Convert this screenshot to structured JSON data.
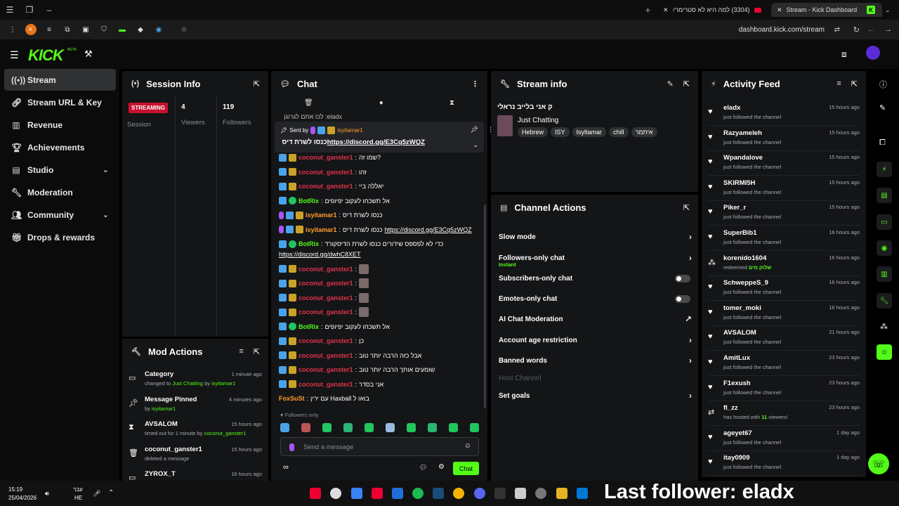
{
  "browser": {
    "tabs": [
      {
        "title": "Stream - Kick Dashboard"
      },
      {
        "title": "(3304) למה היא לא סטרימרית"
      }
    ],
    "url": "dashboard.kick.com/stream"
  },
  "app": {
    "logo": "KICK",
    "logo_badge": "BETA",
    "accent": "#53fc18"
  },
  "sidebar": {
    "items": [
      {
        "label": "Stream",
        "icon": "broadcast-icon",
        "active": true
      },
      {
        "label": "Stream URL & Key",
        "icon": "link-icon"
      },
      {
        "label": "Revenue",
        "icon": "chart-icon"
      },
      {
        "label": "Achievements",
        "icon": "trophy-icon"
      },
      {
        "label": "Studio",
        "icon": "studio-icon",
        "expandable": true
      },
      {
        "label": "Moderation",
        "icon": "wrench-icon"
      },
      {
        "label": "Community",
        "icon": "people-icon",
        "expandable": true
      },
      {
        "label": "Drops & rewards",
        "icon": "gift-icon"
      }
    ]
  },
  "session": {
    "title": "Session Info",
    "status": "STREAMING",
    "status_label": "Session",
    "viewers": "4",
    "viewers_label": "Viewers",
    "followers": "119",
    "followers_label": "Followers"
  },
  "mod_actions": {
    "title": "Mod Actions",
    "items": [
      {
        "icon": "category-icon",
        "name": "Category",
        "sub1": "changed to ",
        "sub_hl": "Just Chatting",
        "sub2": " by ",
        "sub_user": "isyitamar1",
        "time": "1 minute ago"
      },
      {
        "icon": "pin-icon",
        "name": "Message Pinned",
        "sub1": "by ",
        "sub_hl": "",
        "sub2": "",
        "sub_user": "isyitamar1",
        "time": "4 minutes ago"
      },
      {
        "icon": "hourglass-icon",
        "name": "AVSALOM",
        "sub1": "timed out for 1 minute by ",
        "sub_hl": "",
        "sub2": "",
        "sub_user": "coconut_ganster1",
        "time": "15 hours ago"
      },
      {
        "icon": "trash-icon",
        "name": "coconut_ganster1",
        "sub1": "deleted a message",
        "sub_hl": "",
        "sub2": "",
        "sub_user": "",
        "time": "15 hours ago"
      },
      {
        "icon": "category-icon",
        "name": "ZYROX_T",
        "sub1": "",
        "sub_hl": "",
        "sub2": "",
        "sub_user": "",
        "time": "16 hours ago"
      }
    ]
  },
  "chat": {
    "title": "Chat",
    "top_partial": "eladx: לכו אתם לגרוגן",
    "pinned": {
      "sent_by_label": "Sent by",
      "user": "isyitamar1",
      "text": "כנסו לשרת דיס ",
      "link": "https://discord.gg/E3Cq5zWQZ"
    },
    "messages": [
      {
        "user": "coconut_ganster1",
        "color": "red",
        "badges": [
          "mod",
          "vip"
        ],
        "text": "?שמו זה"
      },
      {
        "user": "coconut_ganster1",
        "color": "red",
        "badges": [
          "mod",
          "vip"
        ],
        "text": "זהו"
      },
      {
        "user": "coconut_ganster1",
        "color": "red",
        "badges": [
          "mod",
          "vip"
        ],
        "text": "יאללה ביי"
      },
      {
        "user": "BotRix",
        "color": "green",
        "badges": [
          "mod",
          "bot"
        ],
        "text": "אל תשכחו לעקוב יפיופים"
      },
      {
        "user": "isyitamar1",
        "color": "orange",
        "badges": [
          "mic",
          "mod",
          "vip"
        ],
        "text": "כנסו לשרת דיס"
      },
      {
        "user": "isyitamar1",
        "color": "orange",
        "badges": [
          "mic",
          "mod",
          "vip"
        ],
        "text": "כנסו לשרת דיס ",
        "link": "https://discord.gg/E3Cq5zWQZ"
      },
      {
        "user": "BotRix",
        "color": "green",
        "badges": [
          "mod",
          "bot"
        ],
        "text": "כדי לא לפספס שידורים כנסו לשרת הדיסקורד",
        "link2": "https://discord.gg/dwhC8XET"
      },
      {
        "user": "coconut_ganster1",
        "color": "red",
        "badges": [
          "mod",
          "vip"
        ],
        "text": "",
        "emote": true
      },
      {
        "user": "coconut_ganster1",
        "color": "red",
        "badges": [
          "mod",
          "vip"
        ],
        "text": "",
        "emote": true
      },
      {
        "user": "coconut_ganster1",
        "color": "red",
        "badges": [
          "mod",
          "vip"
        ],
        "text": "",
        "emote": true
      },
      {
        "user": "coconut_ganster1",
        "color": "red",
        "badges": [
          "mod",
          "vip"
        ],
        "text": "",
        "emote": true
      },
      {
        "user": "BotRix",
        "color": "green",
        "badges": [
          "mod",
          "bot"
        ],
        "text": "אל תשכחו לעקוב יפיופים"
      },
      {
        "user": "coconut_ganster1",
        "color": "red",
        "badges": [
          "mod",
          "vip"
        ],
        "text": "כן"
      },
      {
        "user": "coconut_ganster1",
        "color": "red",
        "badges": [
          "mod",
          "vip"
        ],
        "text": "אבל כזה הרבה יותר טוב"
      },
      {
        "user": "coconut_ganster1",
        "color": "red",
        "badges": [
          "mod",
          "vip"
        ],
        "text": "שומעים אותך הרבה יותר טוב"
      },
      {
        "user": "coconut_ganster1",
        "color": "red",
        "badges": [
          "mod",
          "vip"
        ],
        "text": "אני בסדר"
      },
      {
        "user": "FoxSuSt",
        "color": "orange",
        "badges": [],
        "text": "בואו ל Haxball עם ירין"
      }
    ],
    "followers_only_label": "Followers only",
    "input_placeholder": "Send a message",
    "send_label": "Chat"
  },
  "stream_info": {
    "title": "Stream info",
    "stream_title": "ק אני בלייב נראלי",
    "category": "Just Chatting",
    "tags": [
      "Hebrew",
      "ISY",
      "Isyltamar",
      "chill",
      "איתמר"
    ]
  },
  "channel_actions": {
    "title": "Channel Actions",
    "items": [
      {
        "label": "Slow mode",
        "control": "arrow"
      },
      {
        "label": "Followers-only chat",
        "sub": "Instant",
        "control": "arrow"
      },
      {
        "label": "Subscribers-only chat",
        "control": "toggle",
        "on": false
      },
      {
        "label": "Emotes-only chat",
        "control": "toggle",
        "on": false
      },
      {
        "label": "AI Chat Moderation",
        "control": "external"
      },
      {
        "label": "Account age restriction",
        "control": "arrow"
      },
      {
        "label": "Banned words",
        "control": "arrow"
      },
      {
        "label": "Host Channel",
        "control": "none",
        "disabled": true
      },
      {
        "label": "Set goals",
        "control": "arrow"
      }
    ]
  },
  "activity": {
    "title": "Activity Feed",
    "items": [
      {
        "icon": "heart-icon",
        "name": "eladx",
        "sub": "just followed the channel",
        "time": "15 hours ago"
      },
      {
        "icon": "heart-icon",
        "name": "Razyameleh",
        "sub": "just followed the channel",
        "time": "15 hours ago"
      },
      {
        "icon": "heart-icon",
        "name": "Wpandalove",
        "sub": "just followed the channel",
        "time": "15 hours ago"
      },
      {
        "icon": "heart-icon",
        "name": "SKIRMI5H",
        "sub": "just followed the channel",
        "time": "15 hours ago"
      },
      {
        "icon": "heart-icon",
        "name": "Piker_r",
        "sub": "just followed the channel",
        "time": "15 hours ago"
      },
      {
        "icon": "heart-icon",
        "name": "SuperBib1",
        "sub": "just followed the channel",
        "time": "16 hours ago"
      },
      {
        "icon": "redeem-icon",
        "name": "korenido1604",
        "sub": "redeemed ",
        "sub_hl": "שלוק מים",
        "time": "16 hours ago"
      },
      {
        "icon": "heart-icon",
        "name": "SchweppeS_9",
        "sub": "just followed the channel",
        "time": "16 hours ago"
      },
      {
        "icon": "heart-icon",
        "name": "tomer_moki",
        "sub": "just followed the channel",
        "time": "16 hours ago"
      },
      {
        "icon": "heart-icon",
        "name": "AVSALOM",
        "sub": "just followed the channel",
        "time": "21 hours ago"
      },
      {
        "icon": "heart-icon",
        "name": "AmitLux",
        "sub": "just followed the channel",
        "time": "23 hours ago"
      },
      {
        "icon": "heart-icon",
        "name": "F1exush",
        "sub": "just followed the channel",
        "time": "23 hours ago"
      },
      {
        "icon": "host-icon",
        "name": "fl_zz",
        "sub": "has hosted with ",
        "sub_hl": "11",
        "sub_tail": " viewers!",
        "time": "23 hours ago"
      },
      {
        "icon": "heart-icon",
        "name": "ageyet67",
        "sub": "just followed the channel",
        "time": "1 day ago"
      },
      {
        "icon": "heart-icon",
        "name": "itay0909",
        "sub": "just followed the channel",
        "time": "1 day ago"
      }
    ]
  },
  "overlay": {
    "text": "Last follower: eladx"
  },
  "taskbar": {
    "time": "15:19",
    "date": "25/04/2026",
    "lang": "עבר",
    "lang2": "HE"
  }
}
